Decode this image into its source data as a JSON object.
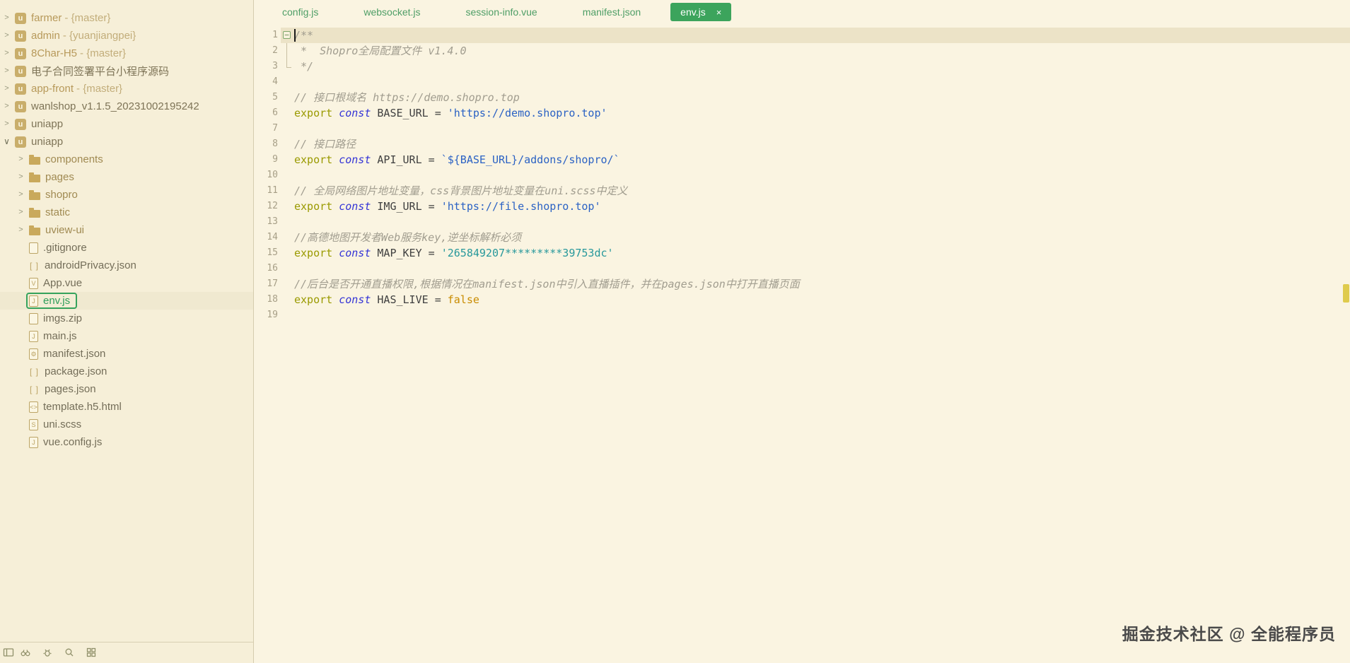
{
  "colors": {
    "accent_green": "#3CA45C",
    "selection_border": "#36A35C",
    "sidebar_bg": "#F6EFD8",
    "editor_bg": "#FAF4E1",
    "current_line_bg": "#ECE3C7",
    "scroll_marker": "#DFCB4C"
  },
  "tabs": [
    {
      "label": "config.js",
      "active": false
    },
    {
      "label": "websocket.js",
      "active": false
    },
    {
      "label": "session-info.vue",
      "active": false
    },
    {
      "label": "manifest.json",
      "active": false
    },
    {
      "label": "env.js",
      "active": true,
      "close_label": "×"
    }
  ],
  "sidebar": {
    "items": [
      {
        "label": "farmer",
        "suffix": "- {master}",
        "type": "project",
        "depth": 0,
        "chevron": "collapsed"
      },
      {
        "label": "admin",
        "suffix": "- {yuanjiangpei}",
        "type": "project",
        "depth": 0,
        "chevron": "collapsed"
      },
      {
        "label": "8Char-H5",
        "suffix": "- {master}",
        "type": "project",
        "depth": 0,
        "chevron": "collapsed"
      },
      {
        "label": "电子合同签署平台小程序源码",
        "suffix": "",
        "type": "project",
        "depth": 0,
        "chevron": "collapsed",
        "dark": true
      },
      {
        "label": "app-front",
        "suffix": "- {master}",
        "type": "project",
        "depth": 0,
        "chevron": "collapsed"
      },
      {
        "label": "wanlshop_v1.1.5_20231002195242",
        "suffix": "",
        "type": "project",
        "depth": 0,
        "chevron": "collapsed",
        "dark": true
      },
      {
        "label": "uniapp",
        "suffix": "",
        "type": "project",
        "depth": 0,
        "chevron": "collapsed",
        "dark": true
      },
      {
        "label": "uniapp",
        "suffix": "",
        "type": "project",
        "depth": 0,
        "chevron": "expanded",
        "dark": true
      },
      {
        "label": "components",
        "type": "folder",
        "depth": 1,
        "chevron": "collapsed"
      },
      {
        "label": "pages",
        "type": "folder",
        "depth": 1,
        "chevron": "collapsed"
      },
      {
        "label": "shopro",
        "type": "folder",
        "depth": 1,
        "chevron": "collapsed"
      },
      {
        "label": "static",
        "type": "folder",
        "depth": 1,
        "chevron": "collapsed"
      },
      {
        "label": "uview-ui",
        "type": "folder",
        "depth": 1,
        "chevron": "collapsed"
      },
      {
        "label": ".gitignore",
        "type": "file",
        "icon": "file-generic-icon",
        "depth": 1
      },
      {
        "label": "androidPrivacy.json",
        "type": "file",
        "icon": "file-json-icon",
        "depth": 1
      },
      {
        "label": "App.vue",
        "type": "file",
        "icon": "file-vue-icon",
        "depth": 1
      },
      {
        "label": "env.js",
        "type": "file",
        "icon": "file-js-icon",
        "depth": 1,
        "selected": true
      },
      {
        "label": "imgs.zip",
        "type": "file",
        "icon": "file-generic-icon",
        "depth": 1
      },
      {
        "label": "main.js",
        "type": "file",
        "icon": "file-js-icon",
        "depth": 1
      },
      {
        "label": "manifest.json",
        "type": "file",
        "icon": "file-manifest-icon",
        "depth": 1
      },
      {
        "label": "package.json",
        "type": "file",
        "icon": "file-json-icon",
        "depth": 1
      },
      {
        "label": "pages.json",
        "type": "file",
        "icon": "file-json-icon",
        "depth": 1
      },
      {
        "label": "template.h5.html",
        "type": "file",
        "icon": "file-html-icon",
        "depth": 1
      },
      {
        "label": "uni.scss",
        "type": "file",
        "icon": "file-scss-icon",
        "depth": 1
      },
      {
        "label": "vue.config.js",
        "type": "file",
        "icon": "file-js-icon",
        "depth": 1
      }
    ]
  },
  "editor": {
    "lines": [
      {
        "num": 1,
        "fold": "box",
        "current": true,
        "cursor": true,
        "tokens": [
          {
            "t": "cmt",
            "v": "/**"
          }
        ]
      },
      {
        "num": 2,
        "fold": "line",
        "tokens": [
          {
            "t": "cmt",
            "v": " *  Shopro全局配置文件 v1.4.0"
          }
        ]
      },
      {
        "num": 3,
        "fold": "end",
        "tokens": [
          {
            "t": "cmt",
            "v": " */"
          }
        ]
      },
      {
        "num": 4,
        "tokens": []
      },
      {
        "num": 5,
        "tokens": [
          {
            "t": "cmt",
            "v": "// 接口根域名 https://demo.shopro.top"
          }
        ]
      },
      {
        "num": 6,
        "tokens": [
          {
            "t": "kw",
            "v": "export "
          },
          {
            "t": "kw2",
            "v": "const "
          },
          {
            "t": "id",
            "v": "BASE_URL "
          },
          {
            "t": "op",
            "v": "= "
          },
          {
            "t": "str",
            "v": "'https://demo.shopro.top'"
          }
        ]
      },
      {
        "num": 7,
        "tokens": []
      },
      {
        "num": 8,
        "tokens": [
          {
            "t": "cmt",
            "v": "// 接口路径"
          }
        ]
      },
      {
        "num": 9,
        "tokens": [
          {
            "t": "kw",
            "v": "export "
          },
          {
            "t": "kw2",
            "v": "const "
          },
          {
            "t": "id",
            "v": "API_URL "
          },
          {
            "t": "op",
            "v": "= "
          },
          {
            "t": "str",
            "v": "`${BASE_URL}/addons/shopro/`"
          }
        ]
      },
      {
        "num": 10,
        "tokens": []
      },
      {
        "num": 11,
        "tokens": [
          {
            "t": "cmt",
            "v": "// 全局网络图片地址变量，css背景图片地址变量在uni.scss中定义"
          }
        ]
      },
      {
        "num": 12,
        "tokens": [
          {
            "t": "kw",
            "v": "export "
          },
          {
            "t": "kw2",
            "v": "const "
          },
          {
            "t": "id",
            "v": "IMG_URL "
          },
          {
            "t": "op",
            "v": "= "
          },
          {
            "t": "str",
            "v": "'https://file.shopro.top'"
          }
        ]
      },
      {
        "num": 13,
        "tokens": []
      },
      {
        "num": 14,
        "tokens": [
          {
            "t": "cmt",
            "v": "//高德地图开发者Web服务key,逆坐标解析必须"
          }
        ]
      },
      {
        "num": 15,
        "tokens": [
          {
            "t": "kw",
            "v": "export "
          },
          {
            "t": "kw2",
            "v": "const "
          },
          {
            "t": "id",
            "v": "MAP_KEY "
          },
          {
            "t": "op",
            "v": "= "
          },
          {
            "t": "str2",
            "v": "'265849207*********39753dc'"
          }
        ]
      },
      {
        "num": 16,
        "tokens": []
      },
      {
        "num": 17,
        "tokens": [
          {
            "t": "cmt",
            "v": "//后台是否开通直播权限,根据情况在manifest.json中引入直播插件，并在pages.json中打开直播页面"
          }
        ]
      },
      {
        "num": 18,
        "tokens": [
          {
            "t": "kw",
            "v": "export "
          },
          {
            "t": "kw2",
            "v": "const "
          },
          {
            "t": "id",
            "v": "HAS_LIVE "
          },
          {
            "t": "op",
            "v": "= "
          },
          {
            "t": "bool",
            "v": "false"
          }
        ]
      },
      {
        "num": 19,
        "tokens": []
      }
    ]
  },
  "watermark": "掘金技术社区 @ 全能程序员"
}
